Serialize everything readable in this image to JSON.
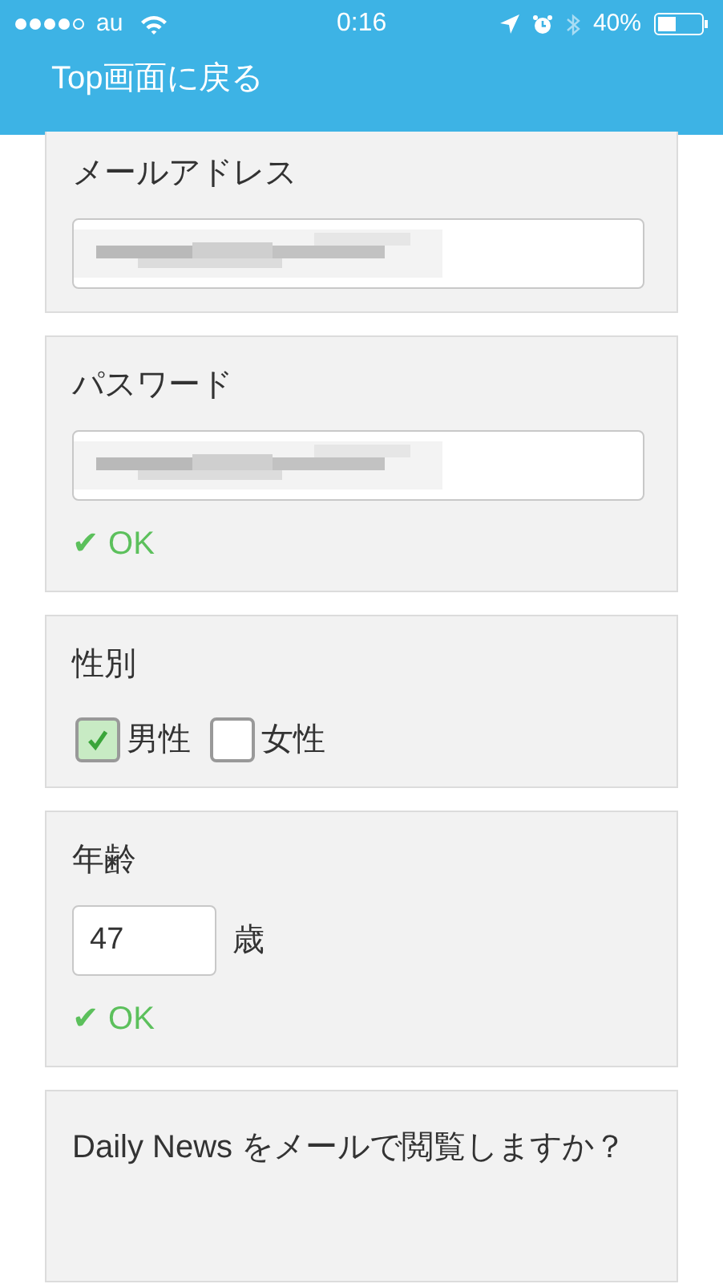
{
  "status_bar": {
    "carrier": "au",
    "time": "0:16",
    "battery": "40%"
  },
  "nav": {
    "back_label": "Top画面に戻る"
  },
  "sections": [
    {
      "kind": "email",
      "label": "メールアドレス",
      "redacted": true
    },
    {
      "kind": "password",
      "label": "パスワード",
      "redacted": true,
      "validation": "✔ OK"
    },
    {
      "kind": "gender",
      "label": "性別",
      "options": [
        {
          "label": "男性",
          "checked": true
        },
        {
          "label": "女性",
          "checked": false
        }
      ]
    },
    {
      "kind": "age",
      "label": "年齢",
      "value": "47",
      "unit": "歳",
      "validation": "✔ OK"
    },
    {
      "kind": "question",
      "label": "Daily News をメールで閲覧しますか？"
    }
  ]
}
